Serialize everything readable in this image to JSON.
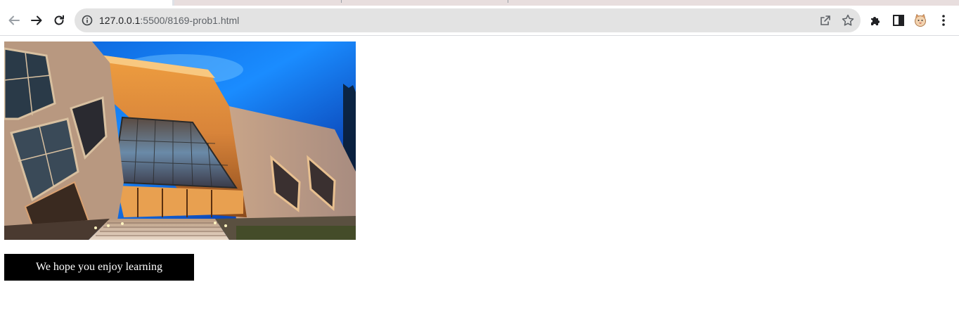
{
  "browser": {
    "url_host": "127.0.0.1",
    "url_rest": ":5500/8169-prob1.html",
    "icons": [
      "back-icon",
      "forward-icon",
      "reload-icon",
      "info-icon",
      "share-icon",
      "bookmark-star-icon",
      "extensions-puzzle-icon",
      "side-panel-icon",
      "profile-avatar-icon",
      "more-menu-icon"
    ]
  },
  "page": {
    "hero_image": "building-photo",
    "button_label": "We hope you enjoy learning"
  },
  "colors": {
    "button_bg": "#000000",
    "button_text": "#ffffff",
    "omnibox_bg": "#e3e3e3"
  }
}
